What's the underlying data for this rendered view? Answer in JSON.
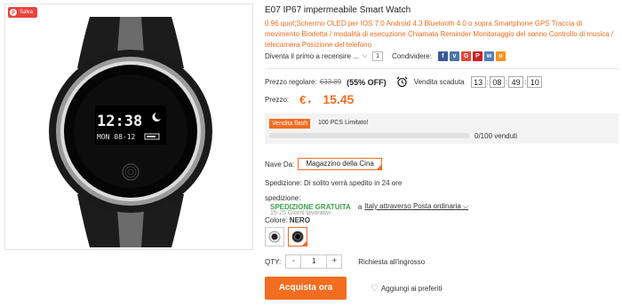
{
  "badge": {
    "label": "Salva"
  },
  "watch_screen": {
    "time": "12:38",
    "date": "MON 08-12"
  },
  "product": {
    "title": "E07 IP67 impermeabile Smart Watch",
    "description": "0.96 &quot;;Schermo OLED per IOS 7.0 Android 4.3 Bluetooth 4.0 o sopra Smartphone GPS Traccia di movimento Biodetta / modalità di esecuzione Chiamata Reminder Monitoraggio del sonno Controllo di musica / telecamera Posizione del telefono"
  },
  "review": {
    "text": "Diventa il primo a recensire ...",
    "count": "1",
    "share_label": "Condividere:"
  },
  "socials": [
    {
      "name": "facebook-icon",
      "glyph": "f",
      "color": "#3b5998"
    },
    {
      "name": "vk-icon",
      "glyph": "v",
      "color": "#4a76a8"
    },
    {
      "name": "google-plus-icon",
      "glyph": "G",
      "color": "#dd4b39"
    },
    {
      "name": "pinterest-icon",
      "glyph": "P",
      "color": "#cb2027"
    },
    {
      "name": "vkontakte-icon",
      "glyph": "w",
      "color": "#5181b8"
    },
    {
      "name": "odnoklassniki-icon",
      "glyph": "o",
      "color": "#f7931e"
    }
  ],
  "pricing": {
    "regular_label": "Prezzo regolare:",
    "regular_price": "€33.89",
    "discount": "(55% OFF)",
    "countdown_label": "Vendita scaduta",
    "countdown": [
      "13",
      "08",
      "49",
      "10"
    ],
    "price_label": "Prezzo:",
    "currency": "€",
    "price": "15.45"
  },
  "flash": {
    "badge": "Vendita flash",
    "text": "100 PCS Limitato!",
    "progress_text": "0/100 venduti",
    "progress_fraction": 0
  },
  "shipping": {
    "ship_from_label": "Nave Da:",
    "warehouse": "Magazzino della Cina",
    "dispatch": "Spedizione: Di solito verrà spedito in 24 ore",
    "label": "spedizione:",
    "free": "SPEDIZIONE GRATUITA",
    "via": "a",
    "method": "Italy attraverso Posta ordinaria",
    "days": "15-25 Giorni lavorativi"
  },
  "color": {
    "label": "Colore:",
    "value": "NERO"
  },
  "quantity": {
    "label": "QTY:",
    "value": "1",
    "minus": "-",
    "plus": "+",
    "wholesale": "Richiesta all'ingrosso"
  },
  "actions": {
    "buy": "Acquista ora",
    "wishlist": "Aggiungi ai preferiti"
  },
  "colors": {
    "accent": "#f26d1f",
    "free_shipping": "#3aa34a",
    "badge_red": "#e8443b"
  }
}
